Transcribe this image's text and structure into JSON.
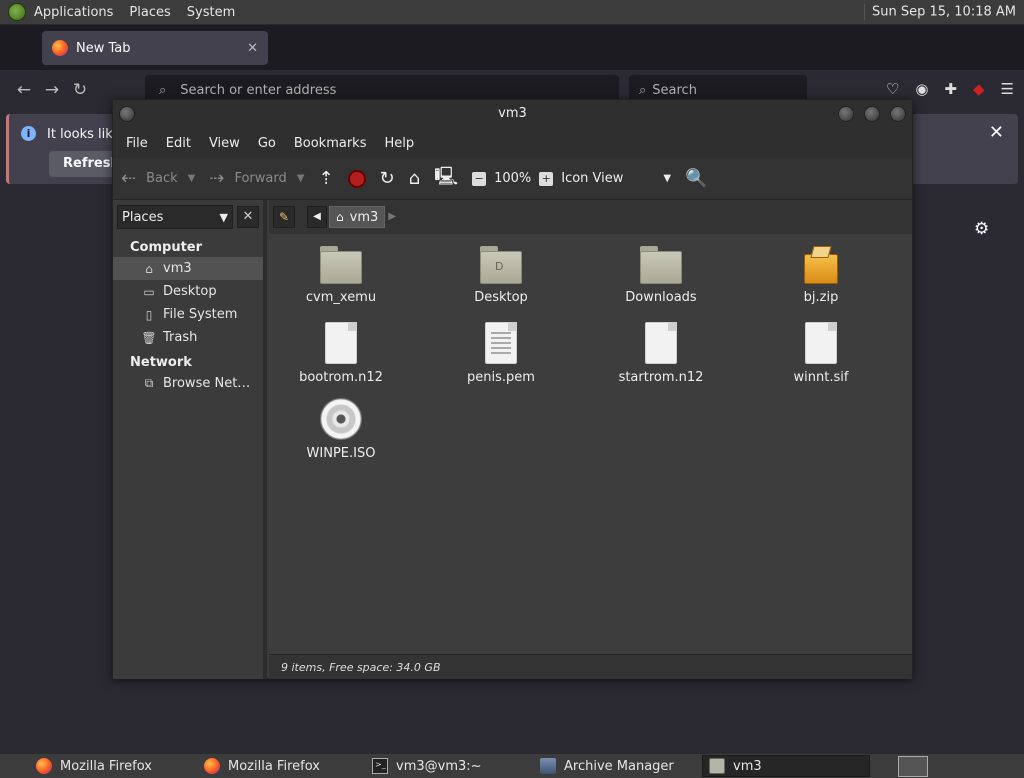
{
  "top_panel": {
    "menus": [
      "Applications",
      "Places",
      "System"
    ],
    "clock": "Sun Sep 15, 10:18 AM"
  },
  "firefox": {
    "tab_title": "New Tab",
    "address_placeholder": "Search or enter address",
    "search_placeholder": "Search",
    "notice_text": "It looks like",
    "refresh_label": "Refresh"
  },
  "file_manager": {
    "window_title": "vm3",
    "menu": [
      "File",
      "Edit",
      "View",
      "Go",
      "Bookmarks",
      "Help"
    ],
    "toolbar": {
      "back": "Back",
      "forward": "Forward",
      "zoom": "100%",
      "view_mode": "Icon View"
    },
    "sidebar": {
      "selector": "Places",
      "sections": [
        {
          "title": "Computer",
          "items": [
            "vm3",
            "Desktop",
            "File System",
            "Trash"
          ]
        },
        {
          "title": "Network",
          "items": [
            "Browse Net…"
          ]
        }
      ]
    },
    "pathbar": {
      "current": "vm3"
    },
    "files": [
      {
        "name": "cvm_xemu",
        "icon": "folder-icon"
      },
      {
        "name": "Desktop",
        "icon": "desktop-folder-icon"
      },
      {
        "name": "Downloads",
        "icon": "folder-icon"
      },
      {
        "name": "bj.zip",
        "icon": "archive-icon"
      },
      {
        "name": "bootrom.n12",
        "icon": "file-icon"
      },
      {
        "name": "penis.pem",
        "icon": "text-file-icon"
      },
      {
        "name": "startrom.n12",
        "icon": "file-icon"
      },
      {
        "name": "winnt.sif",
        "icon": "file-icon"
      },
      {
        "name": "WINPE.ISO",
        "icon": "disc-image-icon"
      }
    ],
    "status": "9 items, Free space: 34.0 GB"
  },
  "taskbar": {
    "tasks": [
      "Mozilla Firefox",
      "Mozilla Firefox",
      "vm3@vm3:~",
      "Archive Manager",
      "vm3"
    ]
  }
}
